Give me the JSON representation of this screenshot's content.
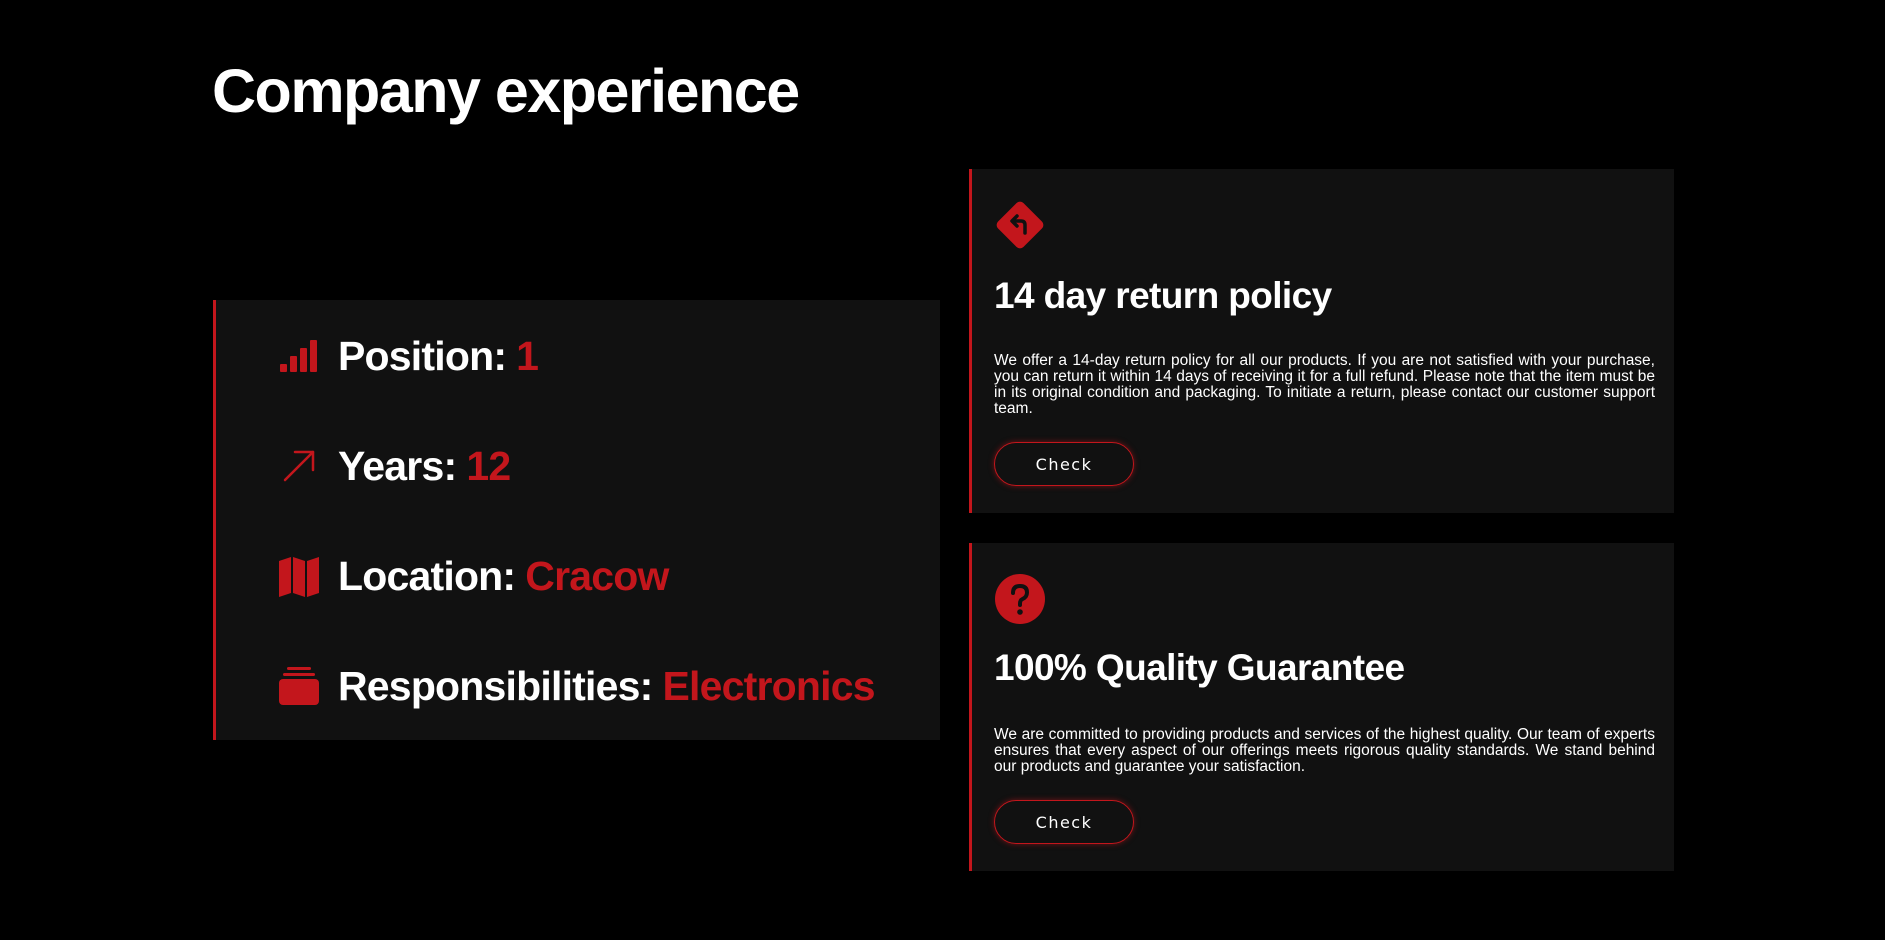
{
  "colors": {
    "background": "#000000",
    "panel": "#111111",
    "accent": "#c3161c",
    "text": "#ffffff"
  },
  "page": {
    "title": "Company experience"
  },
  "experience": {
    "items": [
      {
        "icon": "signal-bars-icon",
        "label": "Position:",
        "value": "1"
      },
      {
        "icon": "arrow-up-right-icon",
        "label": "Years:",
        "value": "12"
      },
      {
        "icon": "map-icon",
        "label": "Location:",
        "value": "Cracow"
      },
      {
        "icon": "briefcase-icon",
        "label": "Responsibilities:",
        "value": "Electronics"
      }
    ]
  },
  "cards": [
    {
      "icon": "return-sign-icon",
      "title": "14 day return policy",
      "text": "We offer a 14-day return policy for all our products. If you are not satisfied with your purchase, you can return it within 14 days of receiving it for a full refund. Please note that the item must be in its original condition and packaging. To initiate a return, please contact our customer support team.",
      "button": "Check"
    },
    {
      "icon": "question-circle-icon",
      "title": "100% Quality Guarantee",
      "text": "We are committed to providing products and services of the highest quality. Our team of experts ensures that every aspect of our offerings meets rigorous quality standards. We stand behind our products and guarantee your satisfaction.",
      "button": "Check"
    }
  ]
}
